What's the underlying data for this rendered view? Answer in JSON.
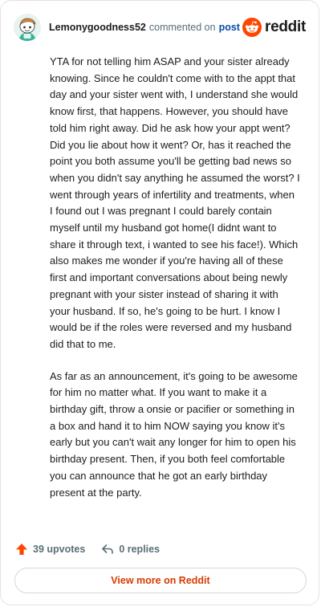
{
  "header": {
    "username": "Lemonygoodness52",
    "verb": "commented on",
    "post_link": "post",
    "brand": "reddit"
  },
  "comment": {
    "paragraphs": [
      "YTA for not telling him ASAP and your sister already knowing. Since he couldn't come with to the appt that day and your sister went with, I understand she would know first, that happens. However, you should have told him right away. Did he ask how your appt went? Did you lie about how it went? Or, has it reached the point you both assume you'll be getting bad news so when you didn't say anything he assumed the worst? I went through years of infertility and treatments, when I found out I was pregnant I could barely contain myself until my husband got home(I didnt want to share it through text, i wanted to see his face!). Which also makes me wonder if you're having all of these first and important conversations about being newly pregnant with your sister instead of sharing it with your husband. If so, he's going to be hurt. I know I would be if the roles were reversed and my husband did that to me.",
      "As far as an announcement, it's going to be awesome for him no matter what. If you want to make it a birthday gift, throw a onsie or pacifier or something in a box and hand it to him NOW saying you know it's early but you can't wait any longer for him to open his birthday present. Then, if you both feel comfortable you can announce that he got an early birthday present at the party."
    ]
  },
  "actions": {
    "upvotes": "39 upvotes",
    "replies": "0 replies"
  },
  "footer": {
    "view_more": "View more on Reddit"
  },
  "colors": {
    "reddit_orange": "#FF4500",
    "link_blue": "#0A4EA8",
    "view_more_text": "#D93A00"
  },
  "icons": [
    "avatar-snoo",
    "reddit-logo-icon",
    "upvote-arrow-icon",
    "reply-icon"
  ]
}
